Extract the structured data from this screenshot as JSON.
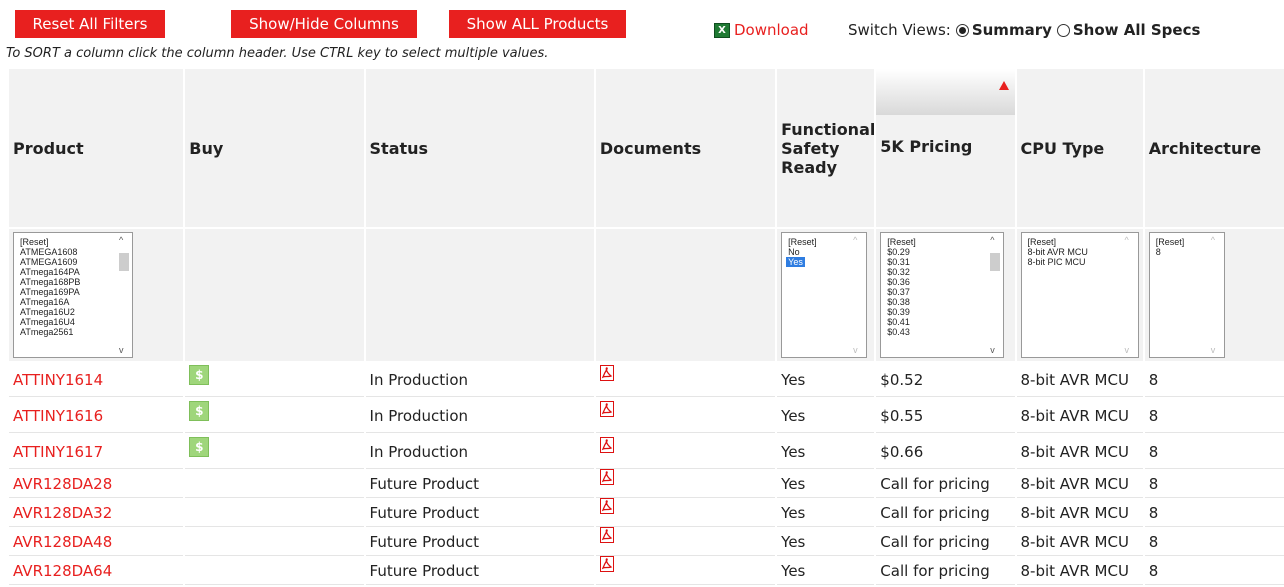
{
  "toolbar": {
    "reset_label": "Reset All Filters",
    "columns_label": "Show/Hide Columns",
    "show_all_label": "Show ALL Products",
    "download_label": "Download",
    "download_icon": "excel-icon",
    "switch_views_label": "Switch Views:",
    "view_summary": "Summary",
    "view_all_specs": "Show All Specs",
    "selected_view": "Summary"
  },
  "hint": "To SORT a column click the column header. Use CTRL key to select multiple values.",
  "columns": [
    "Product",
    "Buy",
    "Status",
    "Documents",
    "Functional Safety Ready",
    "5K Pricing",
    "CPU Type",
    "Architecture"
  ],
  "filters": {
    "product": [
      "[Reset]",
      "ATMEGA1608",
      "ATMEGA1609",
      "ATmega164PA",
      "ATmega168PB",
      "ATmega169PA",
      "ATmega16A",
      "ATmega16U2",
      "ATmega16U4",
      "ATmega2561"
    ],
    "safety": [
      "[Reset]",
      "No",
      "Yes"
    ],
    "safety_selected": "Yes",
    "pricing": [
      "[Reset]",
      "$0.29",
      "$0.31",
      "$0.32",
      "$0.36",
      "$0.37",
      "$0.38",
      "$0.39",
      "$0.41",
      "$0.43"
    ],
    "cpu": [
      "[Reset]",
      "8-bit AVR MCU",
      "8-bit PIC MCU"
    ],
    "arch": [
      "[Reset]",
      "8"
    ]
  },
  "rows": [
    {
      "product": "ATTINY1614",
      "buy": "$",
      "status": "In Production",
      "safety": "Yes",
      "price": "$0.52",
      "cpu": "8-bit AVR MCU",
      "arch": "8"
    },
    {
      "product": "ATTINY1616",
      "buy": "$",
      "status": "In Production",
      "safety": "Yes",
      "price": "$0.55",
      "cpu": "8-bit AVR MCU",
      "arch": "8"
    },
    {
      "product": "ATTINY1617",
      "buy": "$",
      "status": "In Production",
      "safety": "Yes",
      "price": "$0.66",
      "cpu": "8-bit AVR MCU",
      "arch": "8"
    },
    {
      "product": "AVR128DA28",
      "buy": "",
      "status": "Future Product",
      "safety": "Yes",
      "price": "Call for pricing",
      "cpu": "8-bit AVR MCU",
      "arch": "8"
    },
    {
      "product": "AVR128DA32",
      "buy": "",
      "status": "Future Product",
      "safety": "Yes",
      "price": "Call for pricing",
      "cpu": "8-bit AVR MCU",
      "arch": "8"
    },
    {
      "product": "AVR128DA48",
      "buy": "",
      "status": "Future Product",
      "safety": "Yes",
      "price": "Call for pricing",
      "cpu": "8-bit AVR MCU",
      "arch": "8"
    },
    {
      "product": "AVR128DA64",
      "buy": "",
      "status": "Future Product",
      "safety": "Yes",
      "price": "Call for pricing",
      "cpu": "8-bit AVR MCU",
      "arch": "8"
    }
  ],
  "colors": {
    "accent": "#e8201f",
    "buy": "#9fd67b",
    "selection": "#2f7de1"
  }
}
